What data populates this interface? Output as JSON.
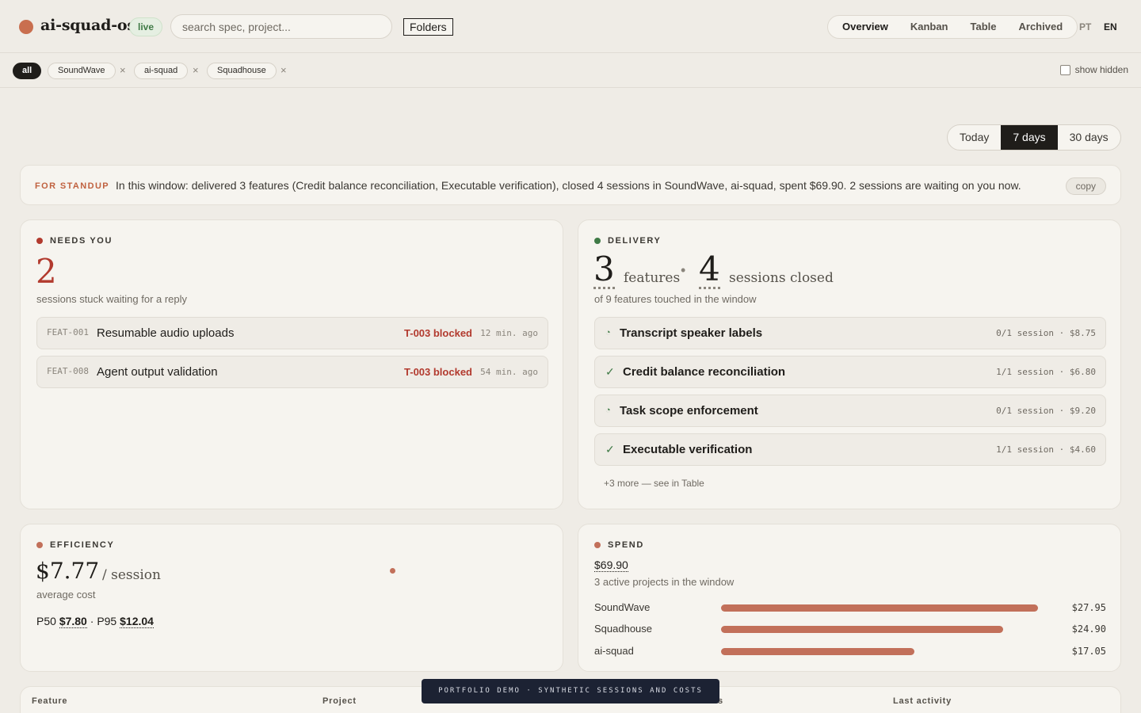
{
  "app": {
    "name": "ai-squad-os",
    "status": "live",
    "folders_label": "Folders"
  },
  "search": {
    "placeholder": "search spec, project..."
  },
  "nav": {
    "tabs": [
      "Overview",
      "Kanban",
      "Table",
      "Archived"
    ],
    "active": "Overview"
  },
  "lang": {
    "pt": "PT",
    "en": "EN",
    "active": "EN"
  },
  "filters": {
    "all": "all",
    "projects": [
      "SoundWave",
      "ai-squad",
      "Squadhouse"
    ],
    "remove_symbol": "×",
    "show_hidden": "show hidden"
  },
  "range": {
    "options": [
      "Today",
      "7 days",
      "30 days"
    ],
    "active": "7 days"
  },
  "standup": {
    "tag": "FOR STANDUP",
    "text": "In this window: delivered 3 features (Credit balance reconciliation, Executable verification), closed 4 sessions in SoundWave, ai-squad, spent $69.90. 2 sessions are waiting on you now.",
    "copy": "copy"
  },
  "needs_you": {
    "title": "NEEDS YOU",
    "count": "2",
    "subtitle": "sessions stuck waiting for a reply",
    "color": "#b23a2e",
    "items": [
      {
        "id": "FEAT-001",
        "name": "Resumable audio uploads",
        "status": "T-003 blocked",
        "ago": "12 min. ago"
      },
      {
        "id": "FEAT-008",
        "name": "Agent output validation",
        "status": "T-003 blocked",
        "ago": "54 min. ago"
      }
    ]
  },
  "delivery": {
    "title": "DELIVERY",
    "features": "3",
    "features_label": "features",
    "sessions": "4",
    "sessions_label": "sessions closed",
    "separator": "•",
    "subtitle": "of 9 features touched in the window",
    "color": "#3f7a46",
    "items": [
      {
        "name": "Transcript speaker labels",
        "icon": "in-progress-icon",
        "glyph": "◔",
        "meta": "0/1 session · $8.75"
      },
      {
        "name": "Credit balance reconciliation",
        "icon": "check-icon",
        "glyph": "✓",
        "meta": "1/1 session · $6.80"
      },
      {
        "name": "Task scope enforcement",
        "icon": "in-progress-icon",
        "glyph": "◔",
        "meta": "0/1 session · $9.20"
      },
      {
        "name": "Executable verification",
        "icon": "check-icon",
        "glyph": "✓",
        "meta": "1/1 session · $4.60"
      }
    ],
    "more": "+3 more — see in Table"
  },
  "efficiency": {
    "title": "EFFICIENCY",
    "value": "$7.77",
    "unit": "/ session",
    "subtitle": "average cost",
    "p50_label": "P50",
    "p50": "$7.80",
    "sep": "·",
    "p95_label": "P95",
    "p95": "$12.04",
    "color": "#c2705a"
  },
  "spend": {
    "title": "SPEND",
    "total": "$69.90",
    "subtitle": "3 active projects in the window",
    "color": "#c2705a",
    "projects": [
      {
        "name": "SoundWave",
        "amount": "$27.95",
        "value": 27.95
      },
      {
        "name": "Squadhouse",
        "amount": "$24.90",
        "value": 24.9
      },
      {
        "name": "ai-squad",
        "amount": "$17.05",
        "value": 17.05
      }
    ]
  },
  "table": {
    "columns": [
      "Feature",
      "Project",
      "s",
      "Last activity"
    ]
  },
  "banner": "PORTFOLIO DEMO · SYNTHETIC SESSIONS AND COSTS"
}
